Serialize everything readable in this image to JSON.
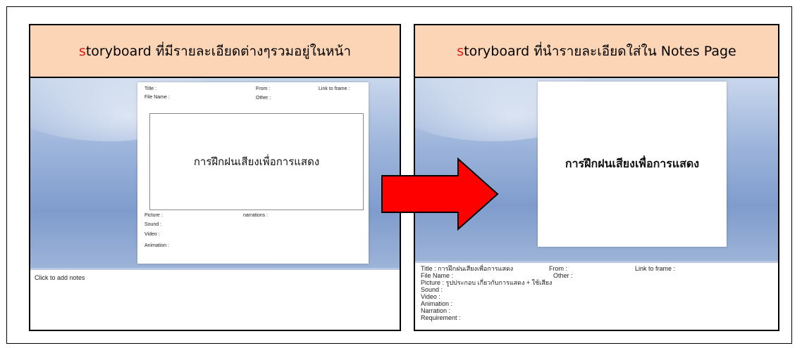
{
  "left_panel": {
    "title_prefix": "s",
    "title_rest": "toryboard ที่มีรายละเอียดต่างๆรวมอยู่ในหน้า",
    "fields": {
      "title": "Title :",
      "file_name": "File Name :",
      "from": "From :",
      "link_to_frame": "Link to frame :",
      "other": "Other :",
      "picture": "Picture :",
      "narrations": "narrations :",
      "sound": "Sound :",
      "video": "Video :",
      "animation": "Animation :"
    },
    "frame_text": "การฝึกฝนเสียงเพื่อการแสดง",
    "notes_placeholder": "Click to add notes"
  },
  "right_panel": {
    "title_prefix": "s",
    "title_rest": "toryboard ที่นำรายละเอียดใส่ใน Notes Page",
    "slide_text": "การฝึกฝนเสียงเพื่อการแสดง",
    "notes": {
      "title": "Title : การฝึกฝนเสียงเพื่อการแสดง",
      "from": "From :",
      "link_to_frame": "Link to frame :",
      "file_name": "File Name :",
      "other": "Other :",
      "picture": "Picture : รูปประกอบ เกี่ยวกับการแสดง + ใช้เสียง",
      "sound": "Sound :",
      "video": "Video :",
      "animation": "Animation :",
      "narration": "Narration :",
      "requirement": "Requirement :"
    }
  },
  "colors": {
    "header_bg": "#fbd5b5",
    "accent_s": "#e01a1a",
    "arrow_fill": "#ff0000"
  },
  "icons": {
    "arrow": "right-arrow-icon"
  }
}
